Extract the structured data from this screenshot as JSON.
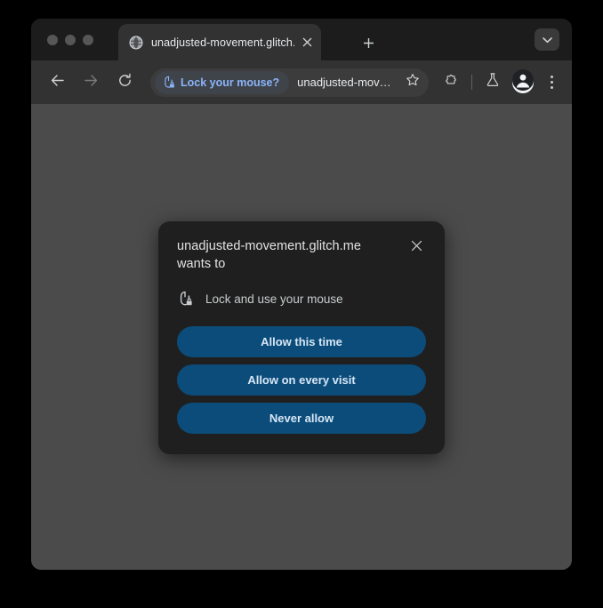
{
  "window": {
    "traffic_lights": [
      "close",
      "minimize",
      "zoom"
    ]
  },
  "tabstrip": {
    "tab": {
      "favicon": "globe-icon",
      "title": "unadjusted-movement.glitch.",
      "close_label": "×"
    },
    "new_tab_label": "+",
    "tab_search": "chevron-down-icon"
  },
  "toolbar": {
    "back": "back-arrow-icon",
    "forward": "forward-arrow-icon",
    "reload": "reload-icon",
    "permission_chip": {
      "icon": "mouse-lock-icon",
      "label": "Lock your mouse?"
    },
    "url": "unadjusted-mov…",
    "bookmark": "star-icon",
    "extensions": "puzzle-piece-icon",
    "experiments": "flask-icon",
    "profile": "avatar-icon",
    "menu": "three-dot-menu-icon"
  },
  "dialog": {
    "title": "unadjusted-movement.glitch.me wants to",
    "close_label": "close-icon",
    "permission": {
      "icon": "mouse-lock-icon",
      "label": "Lock and use your mouse"
    },
    "buttons": [
      {
        "label": "Allow this time",
        "name": "allow-this-time-button"
      },
      {
        "label": "Allow on every visit",
        "name": "allow-every-visit-button"
      },
      {
        "label": "Never allow",
        "name": "never-allow-button"
      }
    ]
  },
  "colors": {
    "backdrop": "#000000",
    "tabstrip_bg": "#1c1c1c",
    "tab_active_bg": "#323232",
    "toolbar_bg": "#323232",
    "omnibox_bg": "#3c3c3c",
    "viewport_bg": "#4b4b4b",
    "dialog_bg": "#1f1f1f",
    "button_blue": "#0b4c7a",
    "chip_text_blue": "#8ab4f8"
  }
}
